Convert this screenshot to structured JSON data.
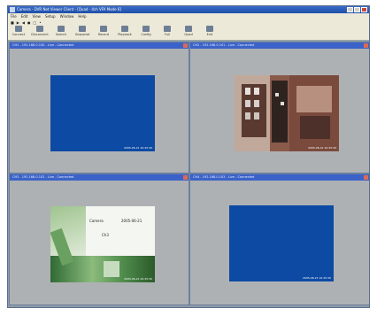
{
  "window": {
    "title": "Camera - DVR Net Viewer Client - [Quad - 4ch VFA Mode 6]"
  },
  "menu": [
    "File",
    "Edit",
    "View",
    "Setup",
    "Window",
    "Help"
  ],
  "small_toolbar": [
    "■",
    "▶",
    "◀",
    "●",
    "□",
    "•"
  ],
  "toolbar": [
    {
      "label": "Connect",
      "icon": "connect-icon"
    },
    {
      "label": "Disconnect",
      "icon": "disconnect-icon"
    },
    {
      "label": "Search",
      "icon": "search-icon"
    },
    {
      "label": "Snapshot",
      "icon": "snapshot-icon"
    },
    {
      "label": "Record",
      "icon": "record-icon"
    },
    {
      "label": "Playback",
      "icon": "playback-icon"
    },
    {
      "label": "Config",
      "icon": "config-icon"
    },
    {
      "label": "Full",
      "icon": "fullscreen-icon"
    },
    {
      "label": "Quad",
      "icon": "quad-icon"
    },
    {
      "label": "Exit",
      "icon": "exit-icon"
    }
  ],
  "panes": [
    {
      "title": "CH1 - 192.168.0.100 - Live - Connected",
      "timestamp": "2005-06-21 10:25:30",
      "content": "no-signal"
    },
    {
      "title": "CH2 - 192.168.0.101 - Live - Connected",
      "timestamp": "2005-06-21 10:25:30",
      "content": "store-shelves"
    },
    {
      "title": "CH3 - 192.168.0.102 - Live - Connected",
      "timestamp": "2005-06-21 10:25:30",
      "content": "overlay-text",
      "overlay": [
        "Camera",
        "2005-06-21",
        "Ch3"
      ]
    },
    {
      "title": "CH4 - 192.168.0.103 - Live - Connected",
      "timestamp": "2005-06-21 10:25:30",
      "content": "no-signal"
    }
  ],
  "colors": {
    "titlebar": "#1f4fa8",
    "pane_title": "#3b62c8",
    "no_signal_blue": "#0d4aa3",
    "workspace": "#aeb1b4"
  }
}
